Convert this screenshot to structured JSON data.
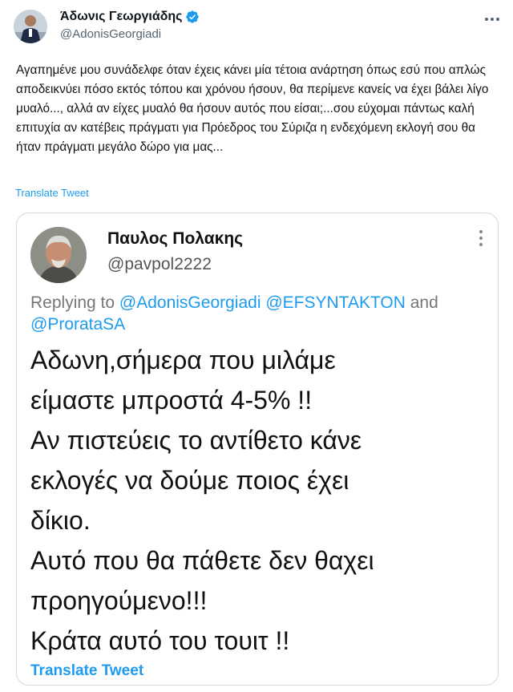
{
  "author": {
    "display_name": "Άδωνις Γεωργιάδης",
    "handle": "@AdonisGeorgiadi",
    "verified": true
  },
  "tweet": {
    "text": "Αγαπημένε μου συνάδελφε όταν έχεις κάνει μία τέτοια ανάρτηση όπως εσύ που απλώς αποδεικνύει πόσο εκτός τόπου και χρόνου ήσουν, θα περίμενε κανείς να έχει βάλει λίγο μυαλό..., αλλά αν είχες μυαλό θα ήσουν αυτός που είσαι;...σου εύχομαι πάντως καλή επιτυχία αν κατέβεις πράγματι για Πρόεδρος του Σύριζα η ενδεχόμενη εκλογή σου θα ήταν πράγματι μεγάλο δώρο για μας...",
    "translate_label": "Translate Tweet"
  },
  "embedded": {
    "display_name": "Παυλος Πολακης",
    "handle": "@pavpol2222",
    "replying_prefix": "Replying to",
    "mention_1": "@AdonisGeorgiadi",
    "mention_2": "@EFSYNTAKTON",
    "and_word": "and",
    "mention_3": "@ProrataSA",
    "lines": [
      "Αδωνη,σήμερα που μιλάμε",
      "είμαστε μπροστά 4-5% !!",
      "Αν πιστεύεις το αντίθετο κάνε",
      "εκλογές να δούμε ποιος έχει",
      "δίκιο.",
      "Αυτό που θα πάθετε δεν θαχει",
      "προηγούμενο!!!",
      "Κράτα αυτό του τουιτ !!"
    ],
    "translate_label": "Translate Tweet"
  },
  "colors": {
    "link": "#1d9bf0",
    "text": "#0f1419",
    "muted": "#536471"
  },
  "icons": [
    "verified-badge-icon",
    "more-options-icon"
  ]
}
